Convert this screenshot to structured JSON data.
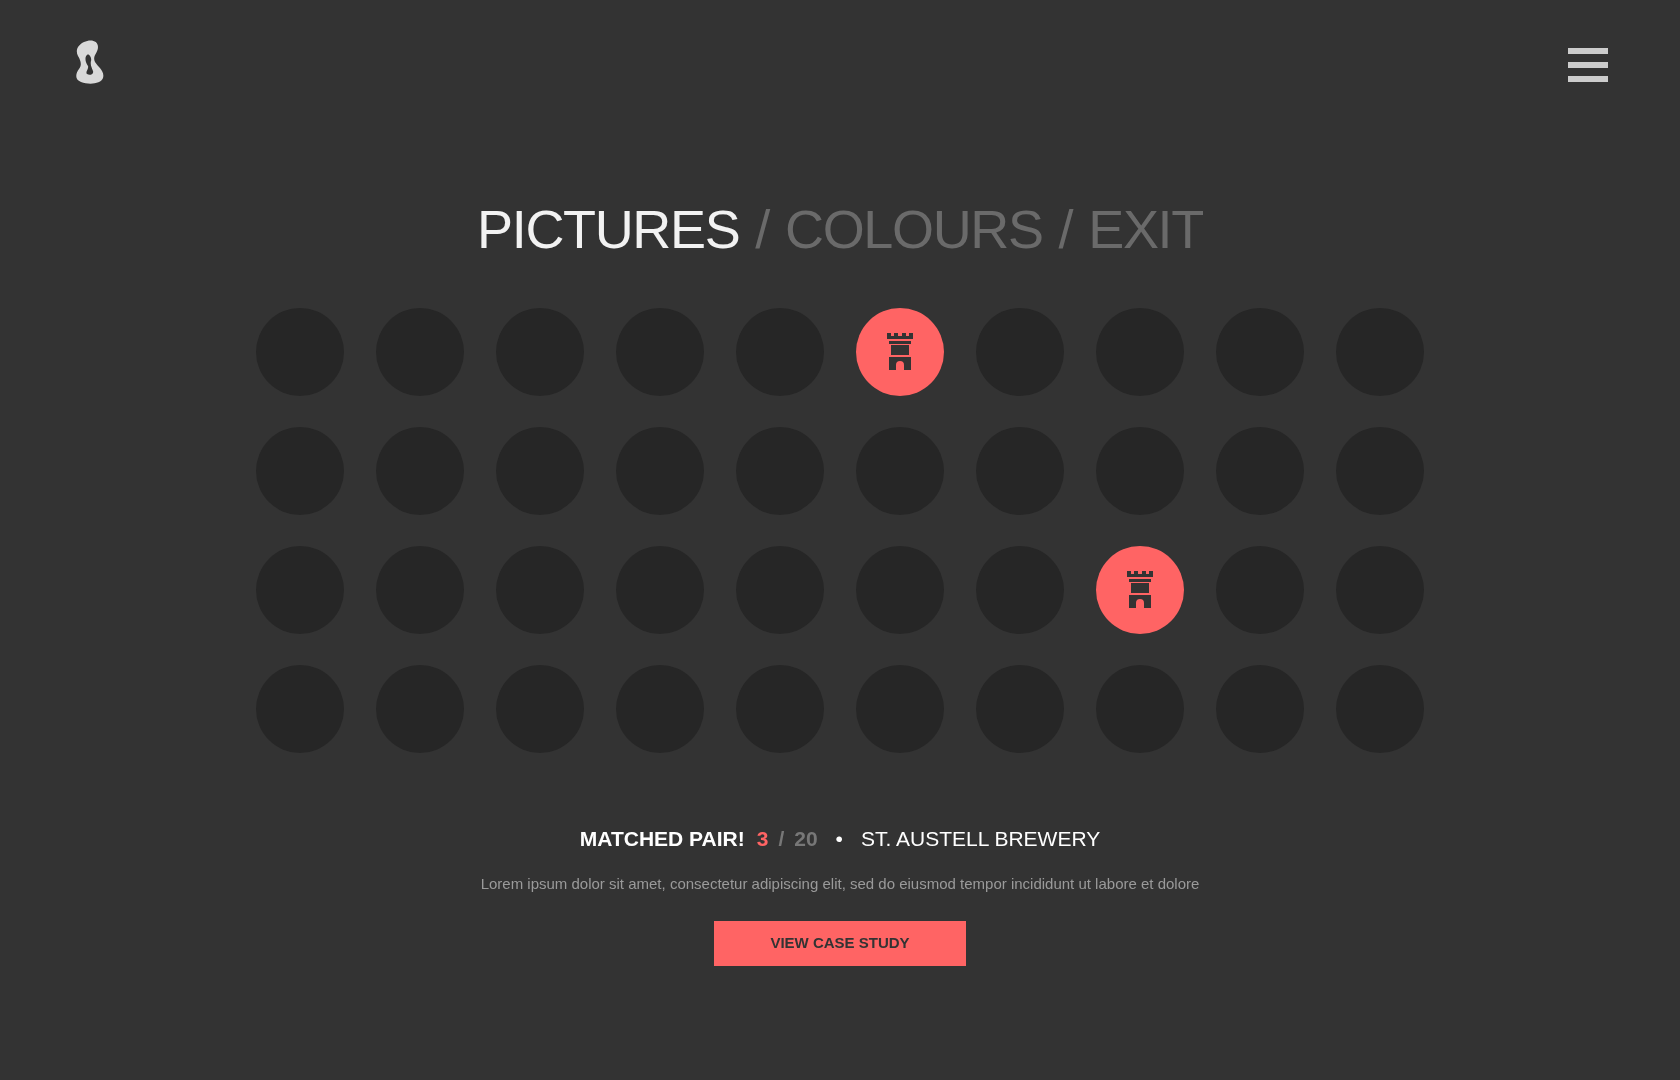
{
  "nav": [
    {
      "label": "PICTURES",
      "selected": true
    },
    {
      "label": "COLOURS",
      "selected": false
    },
    {
      "label": "EXIT",
      "selected": false
    }
  ],
  "nav_separator": "/",
  "tiles": [
    {
      "revealed": false
    },
    {
      "revealed": false
    },
    {
      "revealed": false
    },
    {
      "revealed": false
    },
    {
      "revealed": false
    },
    {
      "revealed": true
    },
    {
      "revealed": false
    },
    {
      "revealed": false
    },
    {
      "revealed": false
    },
    {
      "revealed": false
    },
    {
      "revealed": false
    },
    {
      "revealed": false
    },
    {
      "revealed": false
    },
    {
      "revealed": false
    },
    {
      "revealed": false
    },
    {
      "revealed": false
    },
    {
      "revealed": false
    },
    {
      "revealed": false
    },
    {
      "revealed": false
    },
    {
      "revealed": false
    },
    {
      "revealed": false
    },
    {
      "revealed": false
    },
    {
      "revealed": false
    },
    {
      "revealed": false
    },
    {
      "revealed": false
    },
    {
      "revealed": false
    },
    {
      "revealed": false
    },
    {
      "revealed": true
    },
    {
      "revealed": false
    },
    {
      "revealed": false
    },
    {
      "revealed": false
    },
    {
      "revealed": false
    },
    {
      "revealed": false
    },
    {
      "revealed": false
    },
    {
      "revealed": false
    },
    {
      "revealed": false
    },
    {
      "revealed": false
    },
    {
      "revealed": false
    },
    {
      "revealed": false
    },
    {
      "revealed": false
    }
  ],
  "status": {
    "message": "MATCHED PAIR!",
    "count": "3",
    "separator": "/",
    "total": "20",
    "bullet": "•",
    "project": "ST. AUSTELL BREWERY"
  },
  "description": "Lorem ipsum dolor sit amet, consectetur adipiscing elit, sed do eiusmod tempor incididunt ut labore et dolore",
  "button": "VIEW CASE STUDY"
}
